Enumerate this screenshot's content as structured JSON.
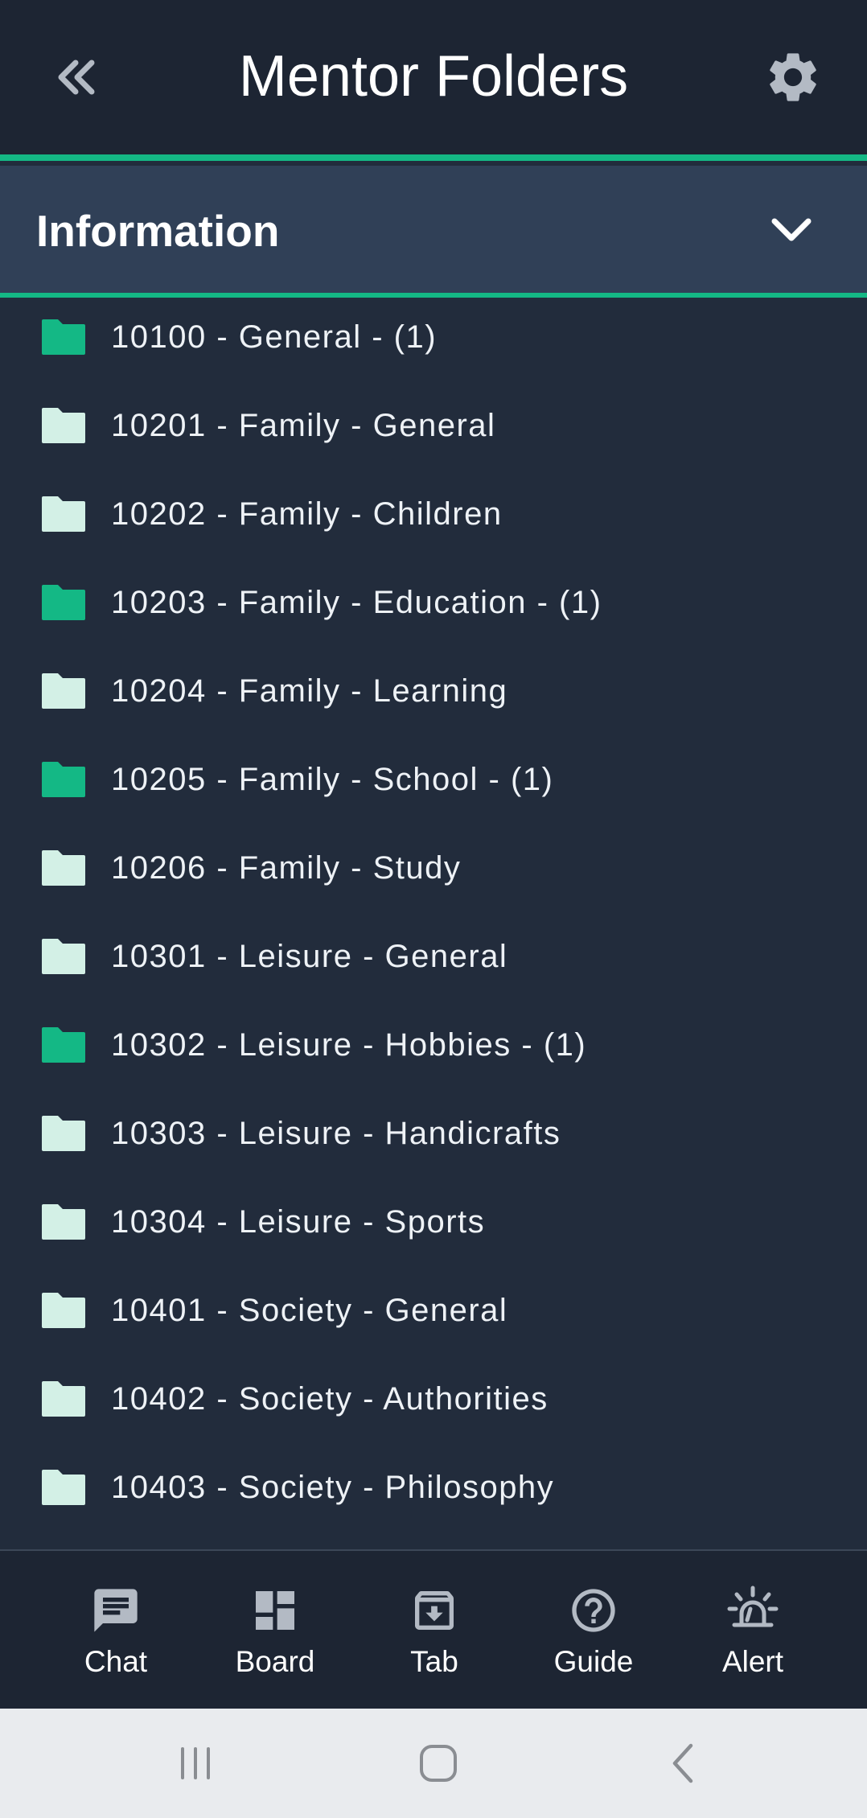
{
  "header": {
    "title": "Mentor Folders",
    "back_icon": "double-chevron-left-icon",
    "settings_icon": "gear-icon"
  },
  "section": {
    "title": "Information",
    "toggle_icon": "chevron-down-icon"
  },
  "colors": {
    "accent": "#14b885",
    "folder_filled": "#14b885",
    "folder_empty": "#d3f0e6",
    "header_bg": "#1d2533",
    "section_bg": "#304057",
    "list_bg": "#222c3c"
  },
  "folders": [
    {
      "label": "10100 - General - (1)",
      "has_items": true
    },
    {
      "label": "10201 - Family - General",
      "has_items": false
    },
    {
      "label": "10202 - Family - Children",
      "has_items": false
    },
    {
      "label": "10203 - Family - Education - (1)",
      "has_items": true
    },
    {
      "label": "10204 - Family - Learning",
      "has_items": false
    },
    {
      "label": "10205 - Family - School - (1)",
      "has_items": true
    },
    {
      "label": "10206 - Family - Study",
      "has_items": false
    },
    {
      "label": "10301 - Leisure - General",
      "has_items": false
    },
    {
      "label": "10302 - Leisure - Hobbies - (1)",
      "has_items": true
    },
    {
      "label": "10303 - Leisure - Handicrafts",
      "has_items": false
    },
    {
      "label": "10304 - Leisure - Sports",
      "has_items": false
    },
    {
      "label": "10401 - Society - General",
      "has_items": false
    },
    {
      "label": "10402 - Society - Authorities",
      "has_items": false
    },
    {
      "label": "10403 - Society - Philosophy",
      "has_items": false
    }
  ],
  "nav": [
    {
      "label": "Chat",
      "icon": "chat-icon"
    },
    {
      "label": "Board",
      "icon": "dashboard-icon"
    },
    {
      "label": "Tab",
      "icon": "archive-icon"
    },
    {
      "label": "Guide",
      "icon": "help-icon"
    },
    {
      "label": "Alert",
      "icon": "siren-icon"
    }
  ],
  "system_nav": {
    "recents_icon": "recents-icon",
    "home_icon": "home-icon",
    "back_icon": "back-icon"
  }
}
